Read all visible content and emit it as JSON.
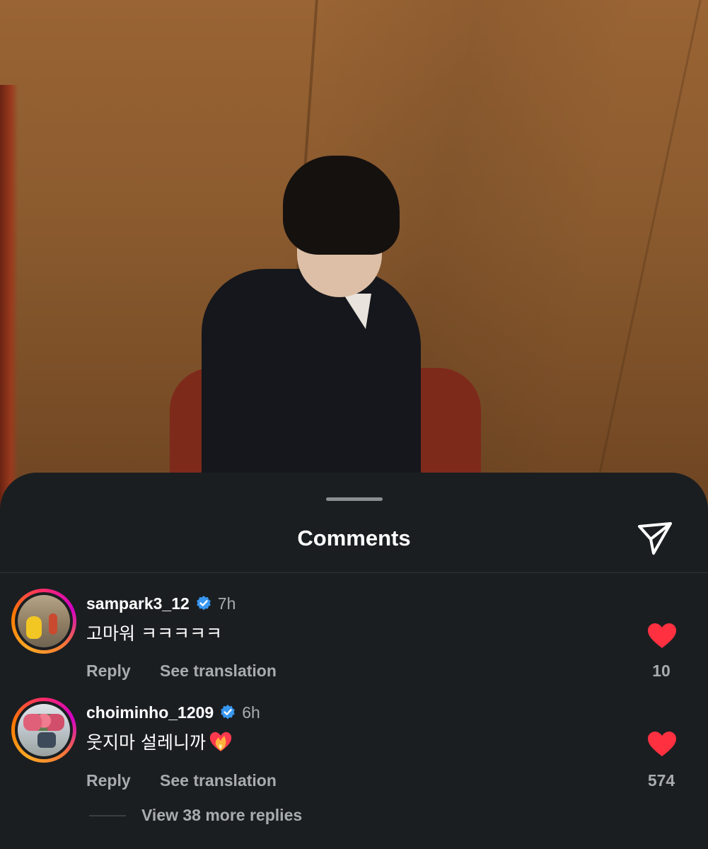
{
  "sheet": {
    "title": "Comments",
    "share_icon": "send-icon"
  },
  "comments": [
    {
      "username": "sampark3_12",
      "verified": true,
      "time": "7h",
      "text": "고마워 ㅋㅋㅋㅋㅋ",
      "reply_label": "Reply",
      "translate_label": "See translation",
      "liked": true,
      "like_count": "10"
    },
    {
      "username": "choiminho_1209",
      "verified": true,
      "time": "6h",
      "text": "웃지마 설레니까",
      "emoji_icon": "burning-heart-icon",
      "reply_label": "Reply",
      "translate_label": "See translation",
      "liked": true,
      "like_count": "574"
    }
  ],
  "view_replies": "View 38 more replies",
  "colors": {
    "background": "#1b1e21",
    "text_primary": "#ffffff",
    "text_secondary": "#a8abaf",
    "verified": "#3897f0",
    "like": "#ff3040"
  }
}
